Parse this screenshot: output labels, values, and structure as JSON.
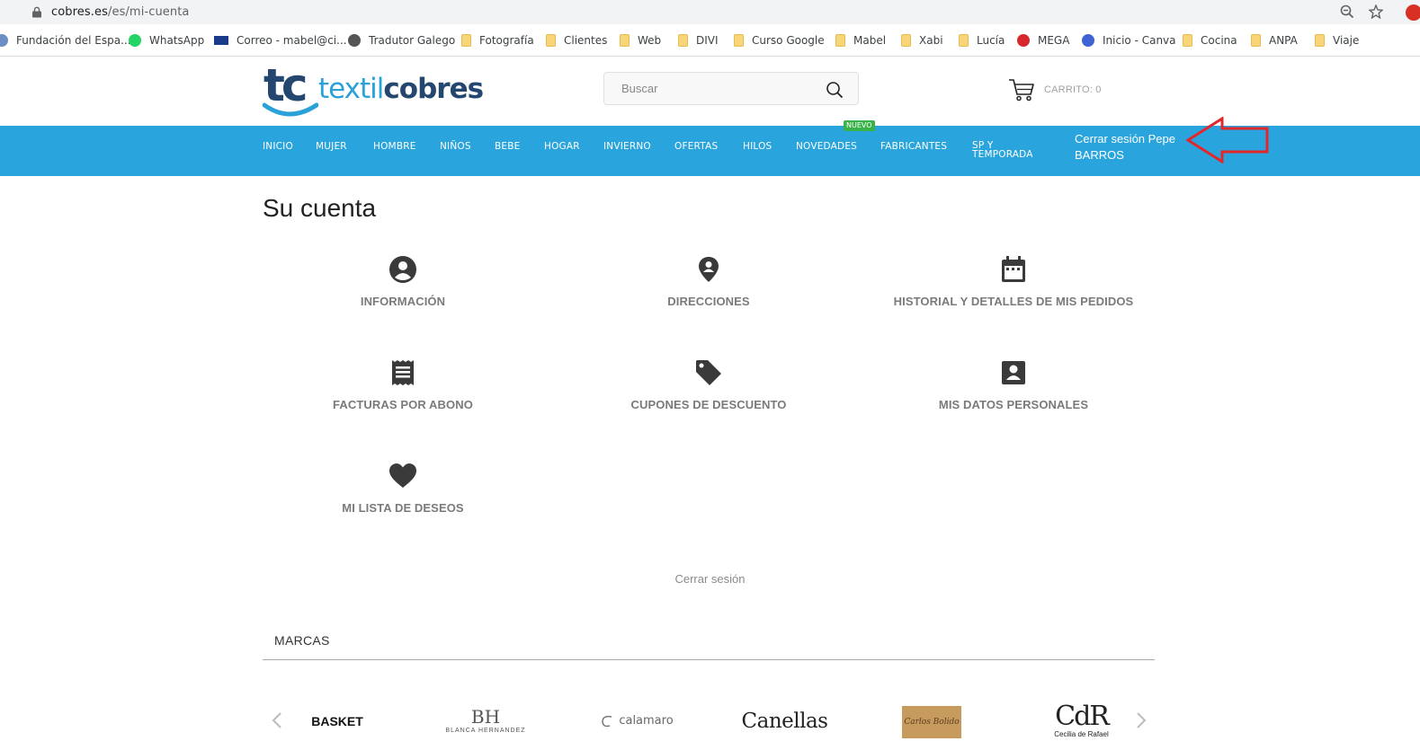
{
  "browser": {
    "url_host": "cobres.es",
    "url_path": "/es/mi-cuenta",
    "bookmarks": [
      {
        "label": "Fundación del Espa...",
        "icon": "globe-icon"
      },
      {
        "label": "WhatsApp",
        "icon": "whatsapp-icon"
      },
      {
        "label": "Correo - mabel@ci...",
        "icon": "mail-icon"
      },
      {
        "label": "Tradutor Galego",
        "icon": "globe-icon"
      },
      {
        "label": "Fotografía",
        "icon": "folder-icon"
      },
      {
        "label": "Clientes",
        "icon": "folder-icon"
      },
      {
        "label": "Web",
        "icon": "folder-icon"
      },
      {
        "label": "DIVI",
        "icon": "folder-icon"
      },
      {
        "label": "Curso Google",
        "icon": "folder-icon"
      },
      {
        "label": "Mabel",
        "icon": "folder-icon"
      },
      {
        "label": "Xabi",
        "icon": "folder-icon"
      },
      {
        "label": "Lucía",
        "icon": "folder-icon"
      },
      {
        "label": "MEGA",
        "icon": "mega-icon"
      },
      {
        "label": "Inicio - Canva",
        "icon": "canva-icon"
      },
      {
        "label": "Cocina",
        "icon": "folder-icon"
      },
      {
        "label": "ANPA",
        "icon": "folder-icon"
      },
      {
        "label": "Viaje",
        "icon": "folder-icon"
      }
    ]
  },
  "header": {
    "logo_mark": "tc",
    "logo_text_1": "textil",
    "logo_text_2": "cobres",
    "search_placeholder": "Buscar",
    "cart_label": "CARRITO: 0"
  },
  "nav": {
    "items": [
      "INICIO",
      "MUJER",
      "HOMBRE",
      "NIÑOS",
      "BEBE",
      "HOGAR",
      "INVIERNO",
      "OFERTAS",
      "HILOS",
      "NOVEDADES",
      "FABRICANTES"
    ],
    "item_two_line_1": "SP Y",
    "item_two_line_2": "TEMPORADA",
    "badge": "NUEVO",
    "logout_line_1": "Cerrar sesión Pepe",
    "logout_line_2": "BARROS"
  },
  "main": {
    "title": "Su cuenta",
    "tiles": [
      {
        "label": "INFORMACIÓN",
        "icon": "user-circle-icon"
      },
      {
        "label": "DIRECCIONES",
        "icon": "location-pin-icon"
      },
      {
        "label": "HISTORIAL Y DETALLES DE MIS PEDIDOS",
        "icon": "calendar-icon"
      },
      {
        "label": "FACTURAS POR ABONO",
        "icon": "receipt-icon"
      },
      {
        "label": "CUPONES DE DESCUENTO",
        "icon": "tag-icon"
      },
      {
        "label": "MIS DATOS PERSONALES",
        "icon": "contact-card-icon"
      },
      {
        "label": "MI LISTA DE DESEOS",
        "icon": "heart-icon"
      }
    ],
    "logout_label": "Cerrar sesión"
  },
  "brands": {
    "title": "MARCAS",
    "items": {
      "basket": "BASKET",
      "bh_big": "BH",
      "bh_small": "BLANCA HERNANDEZ",
      "calamaro": "calamaro",
      "canellas": "Canellas",
      "carlos": "Carlos Bolido",
      "cdr_big": "CdR",
      "cdr_small": "Cecilia de Rafael"
    }
  },
  "colors": {
    "nav_bg": "#2aa4dd",
    "badge_bg": "#3ab24a",
    "arrow": "#e3262b",
    "logo_dark": "#23476f",
    "logo_light": "#2aa1d8"
  }
}
